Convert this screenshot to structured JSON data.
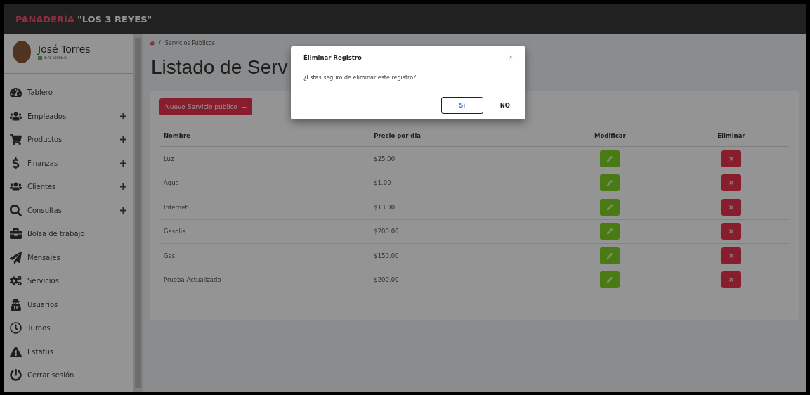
{
  "brand": {
    "name": "PANADERÍA",
    "tagline": "\"LOS 3 REYES\""
  },
  "user": {
    "name": "José Torres",
    "status": "EN LINEA"
  },
  "sidebar": {
    "items": [
      {
        "label": "Tablero",
        "expandable": false
      },
      {
        "label": "Empleados",
        "expandable": true
      },
      {
        "label": "Productos",
        "expandable": true
      },
      {
        "label": "Finanzas",
        "expandable": true
      },
      {
        "label": "Clientes",
        "expandable": true
      },
      {
        "label": "Consultas",
        "expandable": true
      },
      {
        "label": "Bolsa de trabajo",
        "expandable": false
      },
      {
        "label": "Mensajes",
        "expandable": false
      },
      {
        "label": "Servicios",
        "expandable": false
      },
      {
        "label": "Usuarios",
        "expandable": false
      },
      {
        "label": "Turnos",
        "expandable": false
      },
      {
        "label": "Estatus",
        "expandable": false
      },
      {
        "label": "Cerrar sesión",
        "expandable": false
      }
    ]
  },
  "breadcrumb": {
    "separator": "/",
    "current": "Servicios Públicos"
  },
  "page_title": "Listado de Serv",
  "new_button": {
    "label": "Nuevo Servicio público",
    "icon_text": "+"
  },
  "table": {
    "columns": [
      "Nombre",
      "Precio por dia",
      "Modificar",
      "Eliminar"
    ],
    "rows": [
      {
        "name": "Luz",
        "price": "$25.00"
      },
      {
        "name": "Agua",
        "price": "$1.00"
      },
      {
        "name": "Internet",
        "price": "$13.00"
      },
      {
        "name": "Gasolia",
        "price": "$200.00"
      },
      {
        "name": "Gas",
        "price": "$150.00"
      },
      {
        "name": "Prueba Actualizado",
        "price": "$200.00"
      }
    ]
  },
  "dialog": {
    "title": "Eliminar Registro",
    "close": "×",
    "message": "¿Estas seguro de eliminar este registro?",
    "confirm": "Sí",
    "cancel": "NO"
  }
}
